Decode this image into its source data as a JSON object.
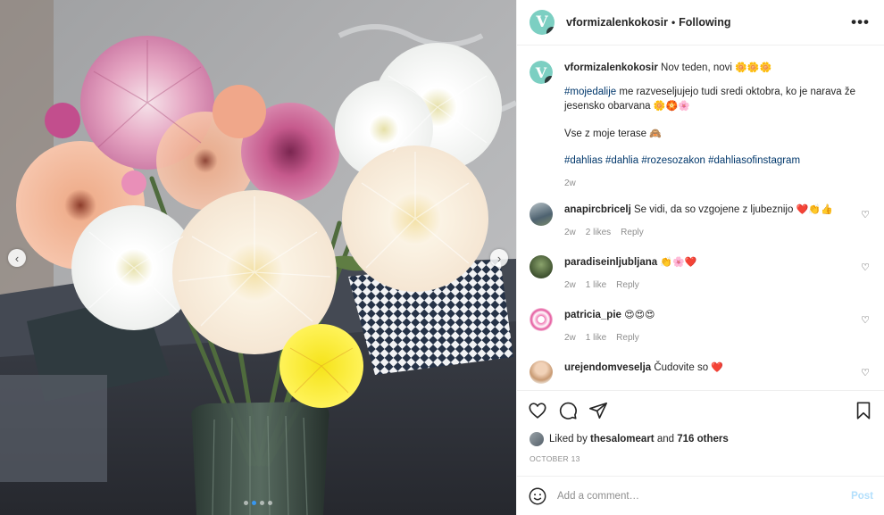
{
  "photo": {
    "alt": "Bouquet of dahlias in a glass vase",
    "slide_count": 4,
    "active_slide": 1
  },
  "post": {
    "username": "vformizalenkokosir",
    "follow_state": "Following",
    "more_icon": "more-horizontal-icon",
    "caption": {
      "line1": "Nov teden, novi",
      "line1_emoji": "🌼🌼🌼",
      "hashtag1": "#mojedalije",
      "line2": " me razveseljujejo tudi sredi oktobra, ko je narava že jesensko obarvana",
      "line2_emoji": "🌼🏵️🌸",
      "line3": "Vse z moje terase",
      "line3_emoji": "🙈",
      "hashtags": "#dahlias #dahlia #rozesozakon #dahliasofinstagram",
      "time": "2w"
    }
  },
  "comments": [
    {
      "username": "anapircbricelj",
      "text": "Se vidi, da so vzgojene z ljubeznijo",
      "emoji": "❤️👏👍",
      "time": "2w",
      "likes": "2 likes",
      "reply": "Reply",
      "avatar_color": "#6e7f8a"
    },
    {
      "username": "paradiseinljubljana",
      "text": "",
      "emoji": "👏🌸❤️",
      "time": "2w",
      "likes": "1 like",
      "reply": "Reply",
      "avatar_color": "#5a6e4a"
    },
    {
      "username": "patricia_pie",
      "text": "",
      "emoji": "😍😍😍",
      "time": "2w",
      "likes": "1 like",
      "reply": "Reply",
      "avatar_color": "#e45a9c"
    },
    {
      "username": "urejendomveselja",
      "text": "Čudovite so",
      "emoji": "❤️",
      "time": "",
      "likes": "",
      "reply": "",
      "avatar_color": "#d9b79a"
    }
  ],
  "likes_line": {
    "prefix": "Liked by",
    "user": "thesalomeart",
    "and": "and",
    "others": "716 others"
  },
  "date": "OCTOBER 13",
  "comment_box": {
    "placeholder": "Add a comment…",
    "post_label": "Post"
  },
  "colors": {
    "accent": "#0095f6",
    "post_disabled": "#b2dffc",
    "hashtag": "#00376b",
    "muted": "#8e8e8e",
    "heart_red": "#ed4956"
  }
}
